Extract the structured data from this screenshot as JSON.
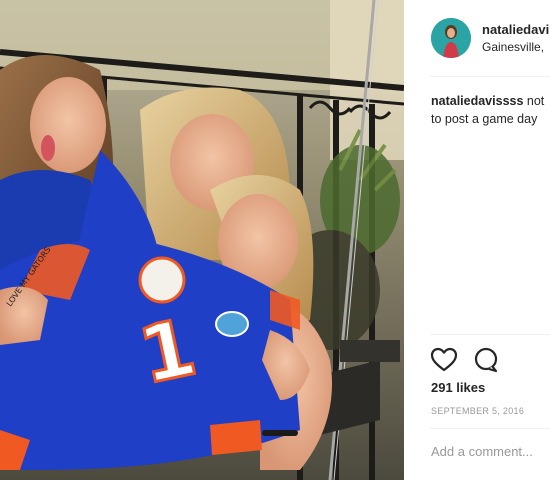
{
  "post": {
    "username": "nataliedavi",
    "location": "Gainesville,",
    "caption_user": "nataliedavissss",
    "caption_text_line1": " not",
    "caption_text_line2": "to post a game day",
    "likes": "291 likes",
    "date": "SEPTEMBER 5, 2016",
    "comment_placeholder": "Add a comment..."
  },
  "photo": {
    "jersey_number": "1",
    "arm_text": "LOVE\nMY\nGATORS"
  },
  "icons": {
    "like": "heart-icon",
    "comment": "comment-bubble-icon",
    "avatar": "avatar"
  },
  "colors": {
    "jersey_blue": "#1f3fc6",
    "jersey_orange": "#f05a22",
    "text_primary": "#262626",
    "text_secondary": "#999999",
    "avatar_bg": "#2ba4a6"
  }
}
